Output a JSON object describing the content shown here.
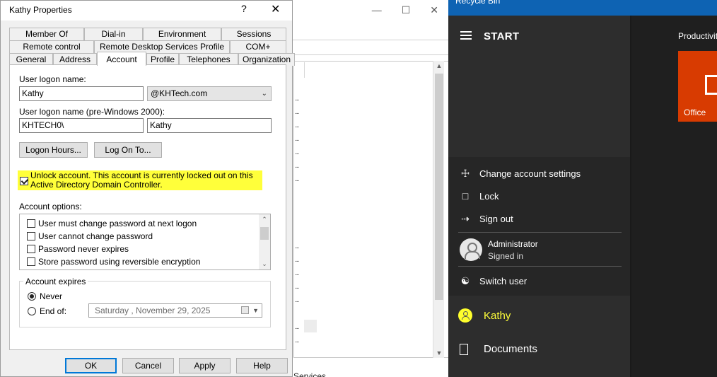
{
  "background_window": {
    "title_caption_buttons": [
      "—",
      "☐",
      "✕"
    ],
    "bottom_text": "Services"
  },
  "dialog": {
    "title": "Kathy Properties",
    "help_glyph": "?",
    "close_glyph": "✕",
    "tabs_row1": [
      "Member Of",
      "Dial-in",
      "Environment",
      "Sessions"
    ],
    "tabs_row2": [
      "Remote control",
      "Remote Desktop Services Profile",
      "COM+"
    ],
    "tabs_row3": [
      "General",
      "Address",
      "Account",
      "Profile",
      "Telephones",
      "Organization"
    ],
    "active_tab": "Account",
    "user_logon_name_label": "User logon name:",
    "user_logon_name_value": "Kathy",
    "domain_suffix": "@KHTech.com",
    "pre2000_label": "User logon name (pre-Windows 2000):",
    "pre2000_domain": "KHTECH0\\",
    "pre2000_user": "Kathy",
    "logon_hours_button": "Logon Hours...",
    "log_on_to_button": "Log On To...",
    "unlock_text": "Unlock account. This account is currently locked out on this Active Directory Domain Controller.",
    "unlock_checked": true,
    "account_options_label": "Account options:",
    "account_options": [
      "User must change password at next logon",
      "User cannot change password",
      "Password never expires",
      "Store password using reversible encryption"
    ],
    "account_expires_label": "Account expires",
    "never_label": "Never",
    "end_of_label": "End of:",
    "end_of_date": "Saturday   ,  November 29, 2025",
    "selected_expiry": "never",
    "buttons": {
      "ok": "OK",
      "cancel": "Cancel",
      "apply": "Apply",
      "help": "Help"
    }
  },
  "start_menu": {
    "top_strip_title": "Recycle Bin",
    "header": "START",
    "account_actions": [
      "Change account settings",
      "Lock",
      "Sign out"
    ],
    "admin_name": "Administrator",
    "admin_status": "Signed in",
    "switch_user": "Switch user",
    "current_user": "Kathy",
    "documents": "Documents",
    "tiles_group": "Productivity",
    "office_tile": "Office",
    "highlight_color": "#ffff2c",
    "office_color": "#d83b01"
  }
}
